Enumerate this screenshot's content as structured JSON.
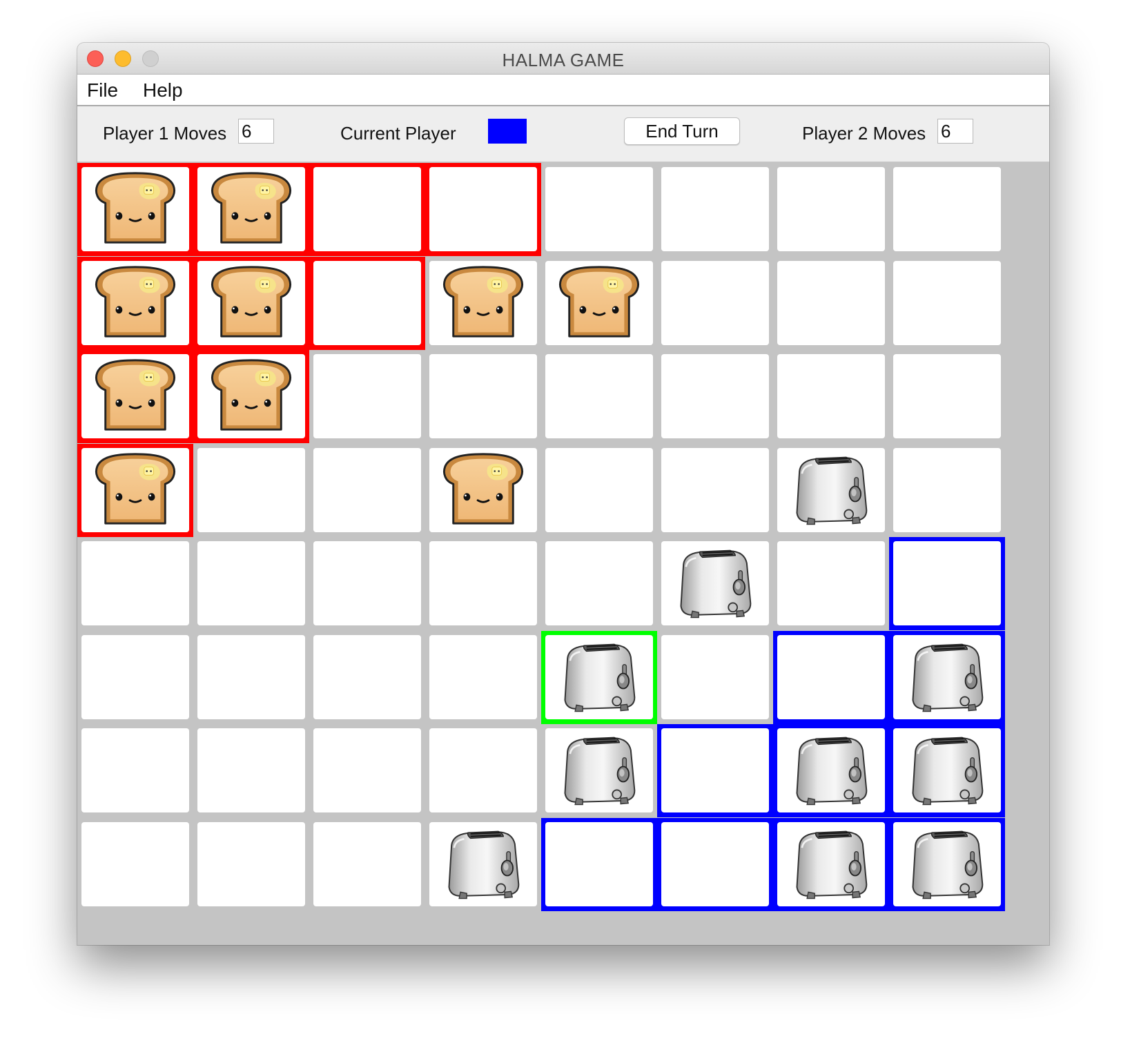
{
  "window": {
    "title": "HALMA GAME"
  },
  "menu": {
    "items": [
      "File",
      "Help"
    ]
  },
  "toolbar": {
    "player1_label": "Player 1 Moves",
    "player1_moves": "6",
    "current_player_label": "Current Player",
    "current_player_color": "#0000ff",
    "end_turn_label": "End Turn",
    "player2_label": "Player 2 Moves",
    "player2_moves": "6"
  },
  "colors": {
    "player1_zone": "#ff0000",
    "player2_zone": "#0000ff",
    "selected": "#00ff00",
    "tile": "#ffffff",
    "board_background": "#c4c4c4"
  },
  "pieces": {
    "player1": "toast-icon",
    "player2": "toaster-icon"
  },
  "board": {
    "rows": 8,
    "cols": 8,
    "zone_legend": "R = player 1 home, B = player 2 home, G = selected, . = none",
    "piece_legend": "T = toast (player 1), S = toaster (player 2), . = empty",
    "zones": [
      "RRRR....",
      "RRR.....",
      "RR......",
      "R.......",
      ".......B",
      "....G.BB",
      ".....BBB",
      "....BBBB"
    ],
    "pieces": [
      "TT......",
      "TT.TT...",
      "TT......",
      "T..T..S.",
      ".....S..",
      "....S..S",
      "....S.SS",
      "...S..SS"
    ]
  }
}
